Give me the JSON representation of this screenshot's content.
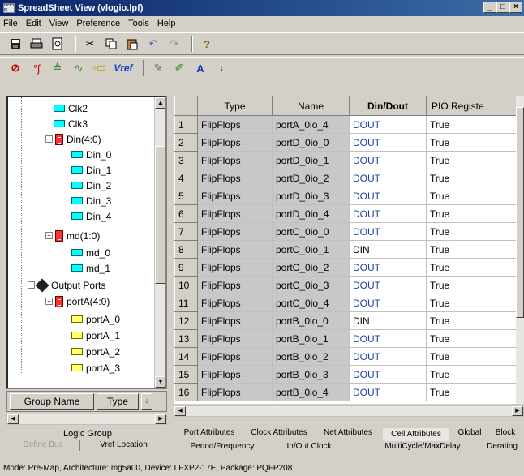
{
  "window": {
    "title": "SpreadSheet View (vlogio.lpf)"
  },
  "menu": [
    "File",
    "Edit",
    "View",
    "Preference",
    "Tools",
    "Help"
  ],
  "toolbar2": {
    "vref_label": "Vref"
  },
  "tree": {
    "items": [
      {
        "label": "Clk2",
        "icon": "signal-icon"
      },
      {
        "label": "Clk3",
        "icon": "signal-icon"
      },
      {
        "label": "Din(4:0)",
        "icon": "bus-icon"
      },
      {
        "label": "Din_0",
        "icon": "signal-icon"
      },
      {
        "label": "Din_1",
        "icon": "signal-icon"
      },
      {
        "label": "Din_2",
        "icon": "signal-icon"
      },
      {
        "label": "Din_3",
        "icon": "signal-icon"
      },
      {
        "label": "Din_4",
        "icon": "signal-icon"
      },
      {
        "label": "md(1:0)",
        "icon": "bus-icon"
      },
      {
        "label": "md_0",
        "icon": "signal-icon"
      },
      {
        "label": "md_1",
        "icon": "signal-icon"
      },
      {
        "label": "Output Ports",
        "icon": "port-icon"
      },
      {
        "label": "portA(4:0)",
        "icon": "bus-icon"
      },
      {
        "label": "portA_0",
        "icon": "output-signal-icon"
      },
      {
        "label": "portA_1",
        "icon": "output-signal-icon"
      },
      {
        "label": "portA_2",
        "icon": "output-signal-icon"
      },
      {
        "label": "portA_3",
        "icon": "output-signal-icon"
      }
    ]
  },
  "group_table": {
    "col_name": "Group Name",
    "col_type": "Type"
  },
  "left_tabs": {
    "logic_group": "Logic Group",
    "define_bus": "Define Bus",
    "vref_location": "Vref Location"
  },
  "grid": {
    "headers": [
      "Type",
      "Name",
      "Din/Dout",
      "PIO Registe"
    ],
    "rows": [
      {
        "n": "1",
        "type": "FlipFlops",
        "name": "portA_0io_4",
        "dir": "DOUT",
        "pio": "True"
      },
      {
        "n": "2",
        "type": "FlipFlops",
        "name": "portD_0io_0",
        "dir": "DOUT",
        "pio": "True"
      },
      {
        "n": "3",
        "type": "FlipFlops",
        "name": "portD_0io_1",
        "dir": "DOUT",
        "pio": "True"
      },
      {
        "n": "4",
        "type": "FlipFlops",
        "name": "portD_0io_2",
        "dir": "DOUT",
        "pio": "True"
      },
      {
        "n": "5",
        "type": "FlipFlops",
        "name": "portD_0io_3",
        "dir": "DOUT",
        "pio": "True"
      },
      {
        "n": "6",
        "type": "FlipFlops",
        "name": "portD_0io_4",
        "dir": "DOUT",
        "pio": "True"
      },
      {
        "n": "7",
        "type": "FlipFlops",
        "name": "portC_0io_0",
        "dir": "DOUT",
        "pio": "True"
      },
      {
        "n": "8",
        "type": "FlipFlops",
        "name": "portC_0io_1",
        "dir": "DIN",
        "pio": "True"
      },
      {
        "n": "9",
        "type": "FlipFlops",
        "name": "portC_0io_2",
        "dir": "DOUT",
        "pio": "True"
      },
      {
        "n": "10",
        "type": "FlipFlops",
        "name": "portC_0io_3",
        "dir": "DOUT",
        "pio": "True"
      },
      {
        "n": "11",
        "type": "FlipFlops",
        "name": "portC_0io_4",
        "dir": "DOUT",
        "pio": "True"
      },
      {
        "n": "12",
        "type": "FlipFlops",
        "name": "portB_0io_0",
        "dir": "DIN",
        "pio": "True"
      },
      {
        "n": "13",
        "type": "FlipFlops",
        "name": "portB_0io_1",
        "dir": "DOUT",
        "pio": "True"
      },
      {
        "n": "14",
        "type": "FlipFlops",
        "name": "portB_0io_2",
        "dir": "DOUT",
        "pio": "True"
      },
      {
        "n": "15",
        "type": "FlipFlops",
        "name": "portB_0io_3",
        "dir": "DOUT",
        "pio": "True"
      },
      {
        "n": "16",
        "type": "FlipFlops",
        "name": "portB_0io_4",
        "dir": "DOUT",
        "pio": "True"
      }
    ]
  },
  "right_tabs": {
    "row1": [
      "Port Attributes",
      "Clock Attributes",
      "Net Attributes",
      "Cell Attributes",
      "Global",
      "Block"
    ],
    "row2": [
      "Period/Frequency",
      "In/Out Clock",
      "MultiCycle/MaxDelay",
      "Derating"
    ]
  },
  "status": {
    "text": "Mode: Pre-Map,    Architecture: mg5a00,  Device: LFXP2-17E,  Package: PQFP208"
  },
  "colors": {
    "title_start": "#0a246a",
    "title_end": "#3a6ea5",
    "dout_text": "#1f3fa8",
    "signal_icon": "#00ffff",
    "bus_icon": "#ff3030",
    "output_icon": "#ffff66"
  }
}
